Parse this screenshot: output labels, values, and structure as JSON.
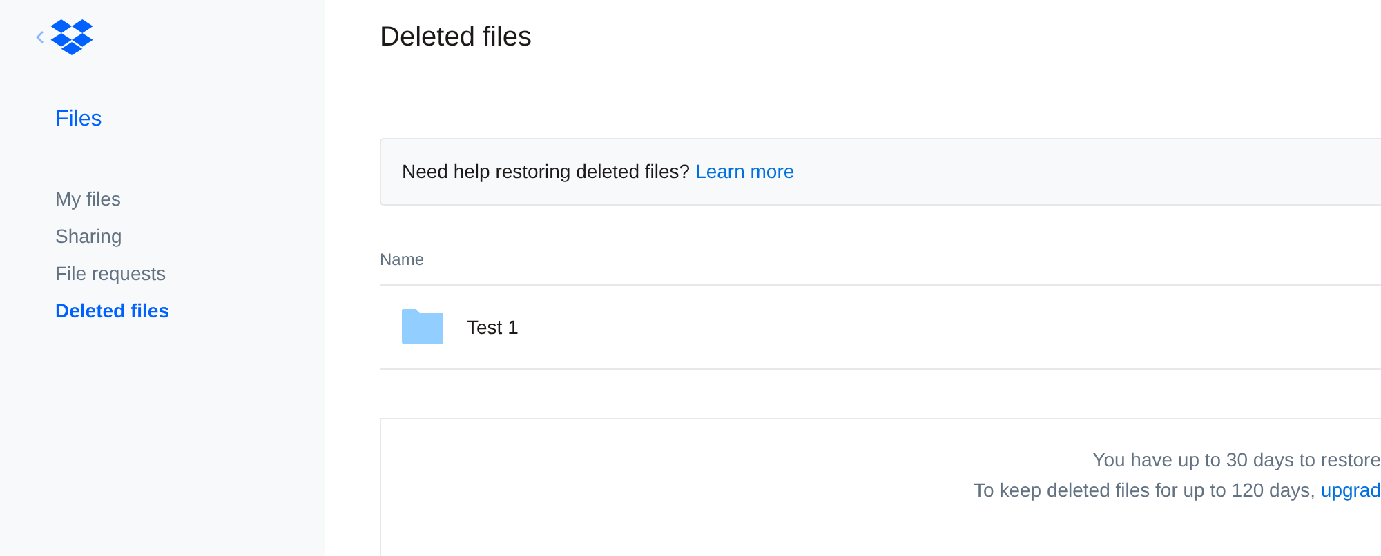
{
  "sidebar": {
    "heading": "Files",
    "items": [
      {
        "label": "My files",
        "selected": false
      },
      {
        "label": "Sharing",
        "selected": false
      },
      {
        "label": "File requests",
        "selected": false
      },
      {
        "label": "Deleted files",
        "selected": true
      }
    ]
  },
  "page_title": "Deleted files",
  "help_banner": {
    "text": "Need help restoring deleted files?",
    "link": "Learn more"
  },
  "table": {
    "columns": [
      "Name"
    ],
    "rows": [
      {
        "name": "Test 1",
        "kind": "folder"
      }
    ]
  },
  "notice": {
    "line_1": "You have up to 30 days to restore",
    "line_2": "To keep deleted files for up to 120 days,",
    "link": "upgrad"
  }
}
